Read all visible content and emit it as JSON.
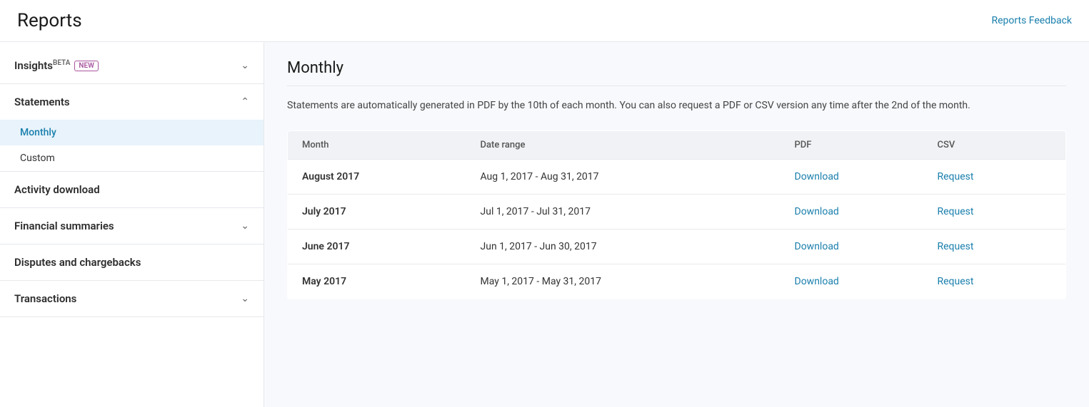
{
  "header": {
    "title": "Reports",
    "feedback_link": "Reports Feedback"
  },
  "sidebar": {
    "sections": [
      {
        "id": "insights",
        "label": "Insights",
        "beta": "BETA",
        "new_badge": "NEW",
        "collapsible": true,
        "expanded": false
      },
      {
        "id": "statements",
        "label": "Statements",
        "collapsible": true,
        "expanded": true,
        "sub_items": [
          {
            "id": "monthly",
            "label": "Monthly",
            "active": true
          },
          {
            "id": "custom",
            "label": "Custom",
            "active": false
          }
        ]
      },
      {
        "id": "activity-download",
        "label": "Activity download",
        "collapsible": false,
        "expanded": false
      },
      {
        "id": "financial-summaries",
        "label": "Financial summaries",
        "collapsible": true,
        "expanded": false
      },
      {
        "id": "disputes-chargebacks",
        "label": "Disputes and chargebacks",
        "collapsible": false,
        "expanded": false
      },
      {
        "id": "transactions",
        "label": "Transactions",
        "collapsible": true,
        "expanded": false
      }
    ]
  },
  "content": {
    "title": "Monthly",
    "description": "Statements are automatically generated in PDF by the 10th of each month. You can also request a PDF or CSV version any time after the 2nd of the month.",
    "table": {
      "columns": [
        "Month",
        "Date range",
        "PDF",
        "CSV"
      ],
      "rows": [
        {
          "month": "August 2017",
          "date_range": "Aug 1, 2017 - Aug 31, 2017",
          "pdf_action": "Download",
          "csv_action": "Request"
        },
        {
          "month": "July 2017",
          "date_range": "Jul 1, 2017 - Jul 31, 2017",
          "pdf_action": "Download",
          "csv_action": "Request"
        },
        {
          "month": "June 2017",
          "date_range": "Jun 1, 2017 - Jun 30, 2017",
          "pdf_action": "Download",
          "csv_action": "Request"
        },
        {
          "month": "May 2017",
          "date_range": "May 1, 2017 - May 31, 2017",
          "pdf_action": "Download",
          "csv_action": "Request"
        }
      ]
    }
  }
}
